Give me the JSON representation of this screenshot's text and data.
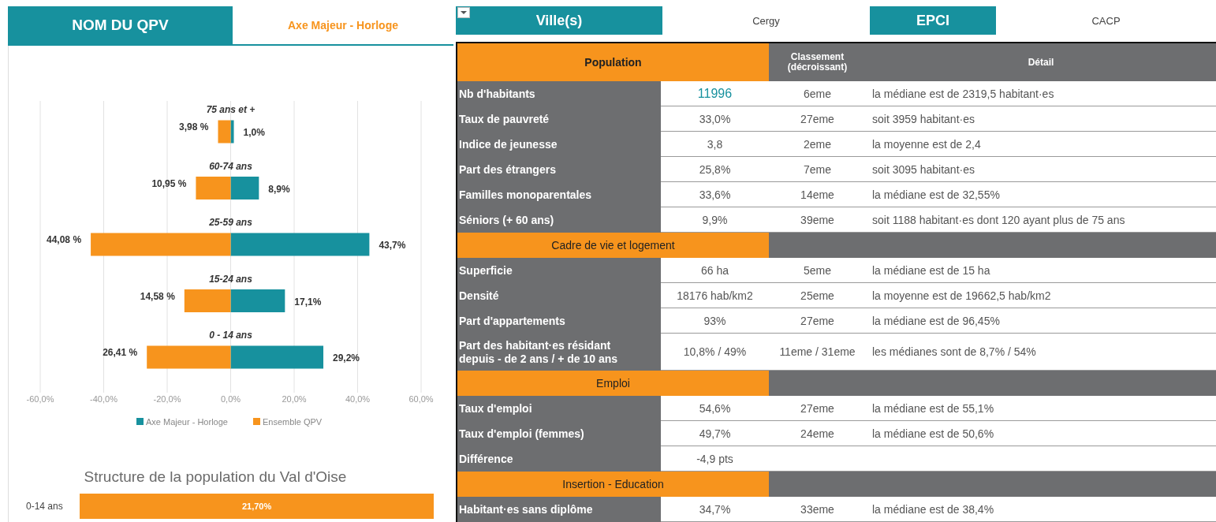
{
  "left_panel": {
    "qpv_label": "NOM DU QPV",
    "qpv_name": "Axe Majeur - Horloge",
    "pyramid": {
      "chart_data": {
        "type": "bar",
        "orientation": "horizontal",
        "grid": true,
        "legend": true,
        "stacked": true,
        "categories": [
          "75 ans et +",
          "60-74 ans",
          "25-59 ans",
          "15-24 ans",
          "0 - 14 ans"
        ],
        "series": [
          {
            "name": "Axe Majeur - Horloge",
            "color": "#17919e",
            "values": [
              1.0,
              8.9,
              43.7,
              17.1,
              29.2
            ],
            "value_labels": [
              "1,0%",
              "8,9%",
              "43,7%",
              "17,1%",
              "29,2%"
            ]
          },
          {
            "name": "Ensemble QPV",
            "color": "#f7941d",
            "values": [
              -3.98,
              -10.95,
              -44.08,
              -14.58,
              -26.41
            ]
          }
        ],
        "annotations": [
          {
            "text": "3,98 %",
            "x": -3.98,
            "y": "75 ans et +"
          },
          {
            "text": "10,95 %",
            "x": -10.95,
            "y": "60-74 ans"
          },
          {
            "text": "44,08 %",
            "x": -44.08,
            "y": "25-59 ans"
          },
          {
            "text": "14,58 %",
            "x": -14.58,
            "y": "15-24 ans"
          },
          {
            "text": "26,41 %",
            "x": -26.41,
            "y": "0 - 14 ans"
          }
        ],
        "xlim": [
          -60,
          60
        ],
        "xticks": [
          {
            "value": -60,
            "label": "-60,0%"
          },
          {
            "value": -40,
            "label": "-40,0%"
          },
          {
            "value": -20,
            "label": "-20,0%"
          },
          {
            "value": 0,
            "label": "0,0%"
          },
          {
            "value": 20,
            "label": "20,0%"
          },
          {
            "value": 40,
            "label": "40,0%"
          },
          {
            "value": 60,
            "label": "60,0%"
          }
        ]
      }
    },
    "val_doise": {
      "chart_data": {
        "type": "bar",
        "orientation": "horizontal",
        "title": "Structure de la population du Val d'Oise",
        "categories": [
          "0-14 ans"
        ],
        "series": [
          {
            "color": "#f7941d",
            "values": [
              21.7
            ],
            "value_labels": [
              "21,70%"
            ]
          }
        ]
      }
    }
  },
  "right_panel": {
    "filters": [
      {
        "label": "Ville(s)",
        "value": "Cergy"
      },
      {
        "label": "EPCI",
        "value": "CACP"
      }
    ],
    "table": {
      "rows": [
        {
          "kind": "section",
          "label": "Population",
          "rank": "Classement (décroissant)",
          "detail": "Détail"
        },
        {
          "kind": "data",
          "label": "Nb d'habitants",
          "value": "11996",
          "rank": "6eme",
          "detail": "la médiane est de 2319,5 habitant·es",
          "emphasized": true
        },
        {
          "kind": "data",
          "label": "Taux de pauvreté",
          "value": "33,0%",
          "rank": "27eme",
          "detail": "soit 3959 habitant·es",
          "emphasized": false
        },
        {
          "kind": "data",
          "label": "Indice de jeunesse",
          "value": "3,8",
          "rank": "2eme",
          "detail": "la moyenne est de 2,4",
          "emphasized": false
        },
        {
          "kind": "data",
          "label": "Part des étrangers",
          "value": "25,8%",
          "rank": "7eme",
          "detail": "soit 3095 habitant·es",
          "emphasized": false
        },
        {
          "kind": "data",
          "label": "Familles monoparentales",
          "value": "33,6%",
          "rank": "14eme",
          "detail": "la médiane est de 32,55%",
          "emphasized": false
        },
        {
          "kind": "data",
          "label": "Séniors (+ 60 ans)",
          "value": "9,9%",
          "rank": "39eme",
          "detail": "soit 1188 habitant·es dont 120 ayant plus de 75 ans",
          "emphasized": false
        },
        {
          "kind": "section",
          "label": "Cadre de vie et logement"
        },
        {
          "kind": "data",
          "label": "Superficie",
          "value": "66 ha",
          "rank": "5eme",
          "detail": "la médiane est de 15 ha",
          "emphasized": false
        },
        {
          "kind": "data",
          "label": "Densité",
          "value": "18176 hab/km2",
          "rank": "25eme",
          "detail": "la moyenne est de 19662,5 hab/km2",
          "emphasized": false
        },
        {
          "kind": "data",
          "label": "Part d'appartements",
          "value": "93%",
          "rank": "27eme",
          "detail": "la médiane est de 96,45%",
          "emphasized": false
        },
        {
          "kind": "data",
          "label": "Part des habitant·es résidant depuis - de 2 ans / + de 10 ans",
          "value": "10,8% / 49%",
          "rank": "11eme / 31eme",
          "detail": "les médianes sont de 8,7% / 54%",
          "emphasized": false
        },
        {
          "kind": "section",
          "label": "Emploi"
        },
        {
          "kind": "data",
          "label": "Taux d'emploi",
          "value": "54,6%",
          "rank": "27eme",
          "detail": "la médiane est de 55,1%",
          "emphasized": false
        },
        {
          "kind": "data",
          "label": "Taux d'emploi (femmes)",
          "value": "49,7%",
          "rank": "24eme",
          "detail": "la médiane est de 50,6%",
          "emphasized": false
        },
        {
          "kind": "data",
          "label": "Différence",
          "value": "-4,9 pts",
          "emphasized": false
        },
        {
          "kind": "section",
          "label": "Insertion - Education"
        },
        {
          "kind": "data",
          "label": "Habitant·es sans diplôme",
          "value": "34,7%",
          "rank": "33eme",
          "detail": "la médiane est de 38,4%",
          "emphasized": false
        }
      ]
    }
  }
}
